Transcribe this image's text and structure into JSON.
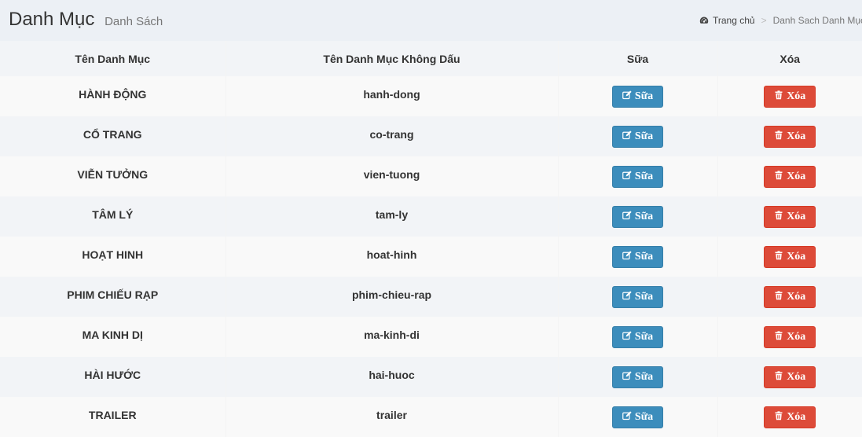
{
  "header": {
    "title": "Danh Mục",
    "subtitle": "Danh Sách"
  },
  "breadcrumb": {
    "home_label": "Trang chủ",
    "separator": ">",
    "current_label": "Danh Sach Danh Mục"
  },
  "table": {
    "columns": [
      "Tên Danh Mục",
      "Tên Danh Mục Không Dấu",
      "Sữa",
      "Xóa"
    ],
    "rows": [
      {
        "name": "HÀNH ĐỘNG",
        "slug": "hanh-dong",
        "edit_label": "Sữa",
        "delete_label": "Xóa"
      },
      {
        "name": "CỔ TRANG",
        "slug": "co-trang",
        "edit_label": "Sữa",
        "delete_label": "Xóa"
      },
      {
        "name": "VIỄN TƯỞNG",
        "slug": "vien-tuong",
        "edit_label": "Sữa",
        "delete_label": "Xóa"
      },
      {
        "name": "TÂM LÝ",
        "slug": "tam-ly",
        "edit_label": "Sữa",
        "delete_label": "Xóa"
      },
      {
        "name": "HOẠT HINH",
        "slug": "hoat-hinh",
        "edit_label": "Sữa",
        "delete_label": "Xóa"
      },
      {
        "name": "PHIM CHIẾU RẠP",
        "slug": "phim-chieu-rap",
        "edit_label": "Sữa",
        "delete_label": "Xóa"
      },
      {
        "name": "MA KINH DỊ",
        "slug": "ma-kinh-di",
        "edit_label": "Sữa",
        "delete_label": "Xóa"
      },
      {
        "name": "HÀI HƯỚC",
        "slug": "hai-huoc",
        "edit_label": "Sữa",
        "delete_label": "Xóa"
      },
      {
        "name": "TRAILER",
        "slug": "trailer",
        "edit_label": "Sữa",
        "delete_label": "Xóa"
      }
    ]
  },
  "icons": {
    "breadcrumb_home": "dashboard-icon",
    "edit_button": "edit-icon",
    "delete_button": "trash-icon"
  },
  "colors": {
    "edit_button": "#3c8dbc",
    "delete_button": "#dd4b39",
    "page_background": "#ecf0f5"
  }
}
